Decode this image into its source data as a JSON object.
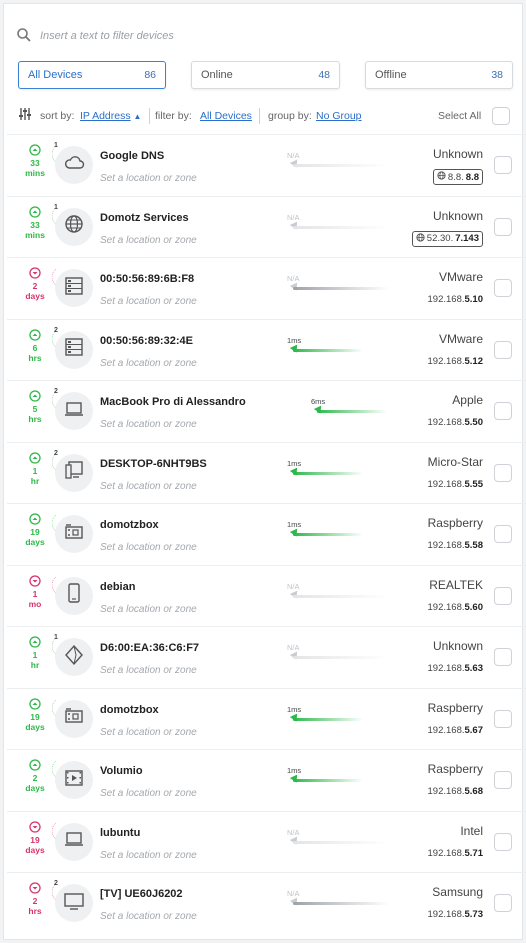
{
  "search": {
    "placeholder": "Insert a text to filter devices"
  },
  "tabs": [
    {
      "label": "All Devices",
      "count": "86",
      "active": true
    },
    {
      "label": "Online",
      "count": "48",
      "active": false
    },
    {
      "label": "Offline",
      "count": "38",
      "active": false
    }
  ],
  "toolbar": {
    "sort_label": "sort by:",
    "sort_value": "IP Address",
    "filter_label": "filter by:",
    "filter_value": "All Devices",
    "group_label": "group by:",
    "group_value": "No Group",
    "select_all": "Select All"
  },
  "colors": {
    "accent": "#2a6fc9",
    "online": "#2fb84a",
    "offline": "#d8336d"
  },
  "devices": [
    {
      "status": "up",
      "since": [
        "33",
        "mins"
      ],
      "badge": "1",
      "icon": "cloud-icon",
      "name": "Google DNS",
      "location": "Set a location or zone",
      "latency": "N/A",
      "latency_state": "na",
      "vendor": "Unknown",
      "ip_prefix": "8.8.",
      "ip_suffix": "8.8",
      "ip_public": true
    },
    {
      "status": "up",
      "since": [
        "33",
        "mins"
      ],
      "badge": "1",
      "icon": "globe-icon",
      "name": "Domotz Services",
      "location": "Set a location or zone",
      "latency": "N/A",
      "latency_state": "na",
      "vendor": "Unknown",
      "ip_prefix": "52.30.",
      "ip_suffix": "7.143",
      "ip_public": true
    },
    {
      "status": "down",
      "since": [
        "2",
        "days"
      ],
      "badge": "",
      "icon": "server-icon",
      "name": "00:50:56:89:6B:F8",
      "location": "Set a location or zone",
      "latency": "N/A",
      "latency_state": "dark",
      "vendor": "VMware",
      "ip_prefix": "192.168.",
      "ip_suffix": "5.10",
      "ip_public": false
    },
    {
      "status": "up",
      "since": [
        "6",
        "hrs"
      ],
      "badge": "2",
      "icon": "server-icon",
      "name": "00:50:56:89:32:4E",
      "location": "Set a location or zone",
      "latency": "1ms",
      "latency_state": "ok",
      "vendor": "VMware",
      "ip_prefix": "192.168.",
      "ip_suffix": "5.12",
      "ip_public": false
    },
    {
      "status": "up",
      "since": [
        "5",
        "hrs"
      ],
      "badge": "2",
      "icon": "laptop-icon",
      "name": "MacBook Pro di Alessandro",
      "location": "Set a location or zone",
      "latency": "6ms",
      "latency_state": "ok",
      "vendor": "Apple",
      "ip_prefix": "192.168.",
      "ip_suffix": "5.50",
      "ip_public": false
    },
    {
      "status": "up",
      "since": [
        "1",
        "hr"
      ],
      "badge": "2",
      "icon": "desktop-icon",
      "name": "DESKTOP-6NHT9BS",
      "location": "Set a location or zone",
      "latency": "1ms",
      "latency_state": "ok",
      "vendor": "Micro-Star",
      "ip_prefix": "192.168.",
      "ip_suffix": "5.55",
      "ip_public": false
    },
    {
      "status": "up",
      "since": [
        "19",
        "days"
      ],
      "badge": "",
      "icon": "board-icon",
      "name": "domotzbox",
      "location": "Set a location or zone",
      "latency": "1ms",
      "latency_state": "ok",
      "vendor": "Raspberry",
      "ip_prefix": "192.168.",
      "ip_suffix": "5.58",
      "ip_public": false
    },
    {
      "status": "down",
      "since": [
        "1",
        "mo"
      ],
      "badge": "",
      "icon": "phone-icon",
      "name": "debian",
      "location": "Set a location or zone",
      "latency": "N/A",
      "latency_state": "na",
      "vendor": "REALTEK",
      "ip_prefix": "192.168.",
      "ip_suffix": "5.60",
      "ip_public": false
    },
    {
      "status": "up",
      "since": [
        "1",
        "hr"
      ],
      "badge": "1",
      "icon": "diamond-icon",
      "name": "D6:00:EA:36:C6:F7",
      "location": "Set a location or zone",
      "latency": "N/A",
      "latency_state": "na",
      "vendor": "Unknown",
      "ip_prefix": "192.168.",
      "ip_suffix": "5.63",
      "ip_public": false
    },
    {
      "status": "up",
      "since": [
        "19",
        "days"
      ],
      "badge": "",
      "icon": "board-icon",
      "name": "domotzbox",
      "location": "Set a location or zone",
      "latency": "1ms",
      "latency_state": "ok",
      "vendor": "Raspberry",
      "ip_prefix": "192.168.",
      "ip_suffix": "5.67",
      "ip_public": false
    },
    {
      "status": "up",
      "since": [
        "2",
        "days"
      ],
      "badge": "",
      "icon": "film-icon",
      "name": "Volumio",
      "location": "Set a location or zone",
      "latency": "1ms",
      "latency_state": "ok",
      "vendor": "Raspberry",
      "ip_prefix": "192.168.",
      "ip_suffix": "5.68",
      "ip_public": false
    },
    {
      "status": "down",
      "since": [
        "19",
        "days"
      ],
      "badge": "",
      "icon": "laptop-icon",
      "name": "lubuntu",
      "location": "Set a location or zone",
      "latency": "N/A",
      "latency_state": "na",
      "vendor": "Intel",
      "ip_prefix": "192.168.",
      "ip_suffix": "5.71",
      "ip_public": false
    },
    {
      "status": "down",
      "since": [
        "2",
        "hrs"
      ],
      "badge": "2",
      "icon": "tv-icon",
      "name": "[TV] UE60J6202",
      "location": "Set a location or zone",
      "latency": "N/A",
      "latency_state": "dark",
      "vendor": "Samsung",
      "ip_prefix": "192.168.",
      "ip_suffix": "5.73",
      "ip_public": false
    }
  ]
}
